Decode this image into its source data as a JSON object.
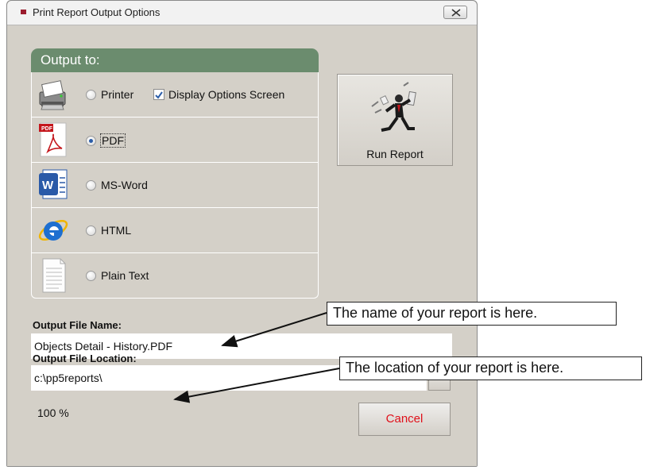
{
  "window": {
    "title": "Print Report Output Options",
    "accent_color": "#9b1c2e"
  },
  "output_group": {
    "header": "Output to:",
    "header_color": "#6b8c6e",
    "options": [
      {
        "label": "Printer",
        "icon": "printer-icon",
        "selected": false
      },
      {
        "label": "PDF",
        "icon": "pdf-icon",
        "selected": true
      },
      {
        "label": "MS-Word",
        "icon": "word-icon",
        "selected": false
      },
      {
        "label": "HTML",
        "icon": "internet-explorer-icon",
        "selected": false
      },
      {
        "label": "Plain Text",
        "icon": "text-document-icon",
        "selected": false
      }
    ],
    "display_options": {
      "label": "Display Options Screen",
      "checked": true
    }
  },
  "run_report": {
    "label": "Run Report",
    "icon": "running-businessman-icon"
  },
  "output_file_name": {
    "label": "Output File Name:",
    "value": "Objects Detail - History.PDF"
  },
  "output_file_location": {
    "label": "Output File Location:",
    "value": "c:\\pp5reports\\"
  },
  "browse_label": "...",
  "progress_text": "100 %",
  "cancel_label": "Cancel",
  "cancel_color": "#e0101a",
  "annotations": {
    "name_note": "The name of your report is here.",
    "location_note": "The location of your report is here."
  }
}
